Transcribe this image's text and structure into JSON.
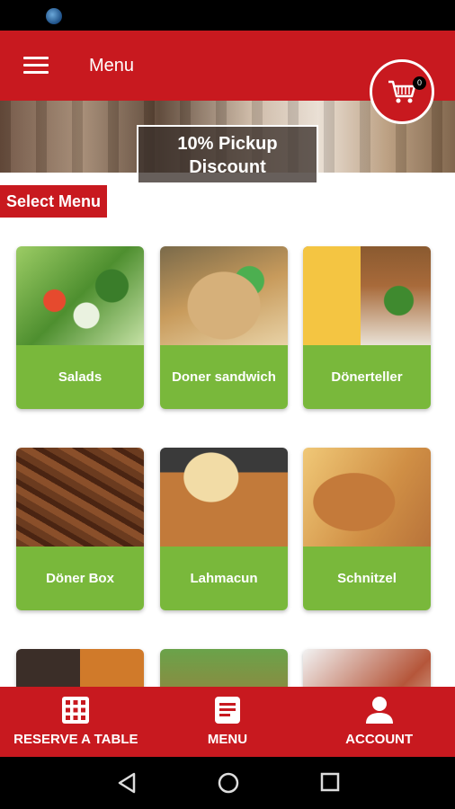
{
  "app_bar": {
    "title": "Menu"
  },
  "cart": {
    "count": "0"
  },
  "banner": {
    "line1": "10% Pickup",
    "line2": "Discount"
  },
  "section_title": "Select Menu",
  "categories": [
    {
      "label": "Salads"
    },
    {
      "label": "Doner sandwich"
    },
    {
      "label": "Dönerteller"
    },
    {
      "label": "Döner Box"
    },
    {
      "label": "Lahmacun"
    },
    {
      "label": "Schnitzel"
    }
  ],
  "bottom_nav": {
    "reserve": "RESERVE A TABLE",
    "menu": "MENU",
    "account": "ACCOUNT"
  },
  "colors": {
    "brand_red": "#c8191f",
    "card_green": "#79b83b"
  }
}
